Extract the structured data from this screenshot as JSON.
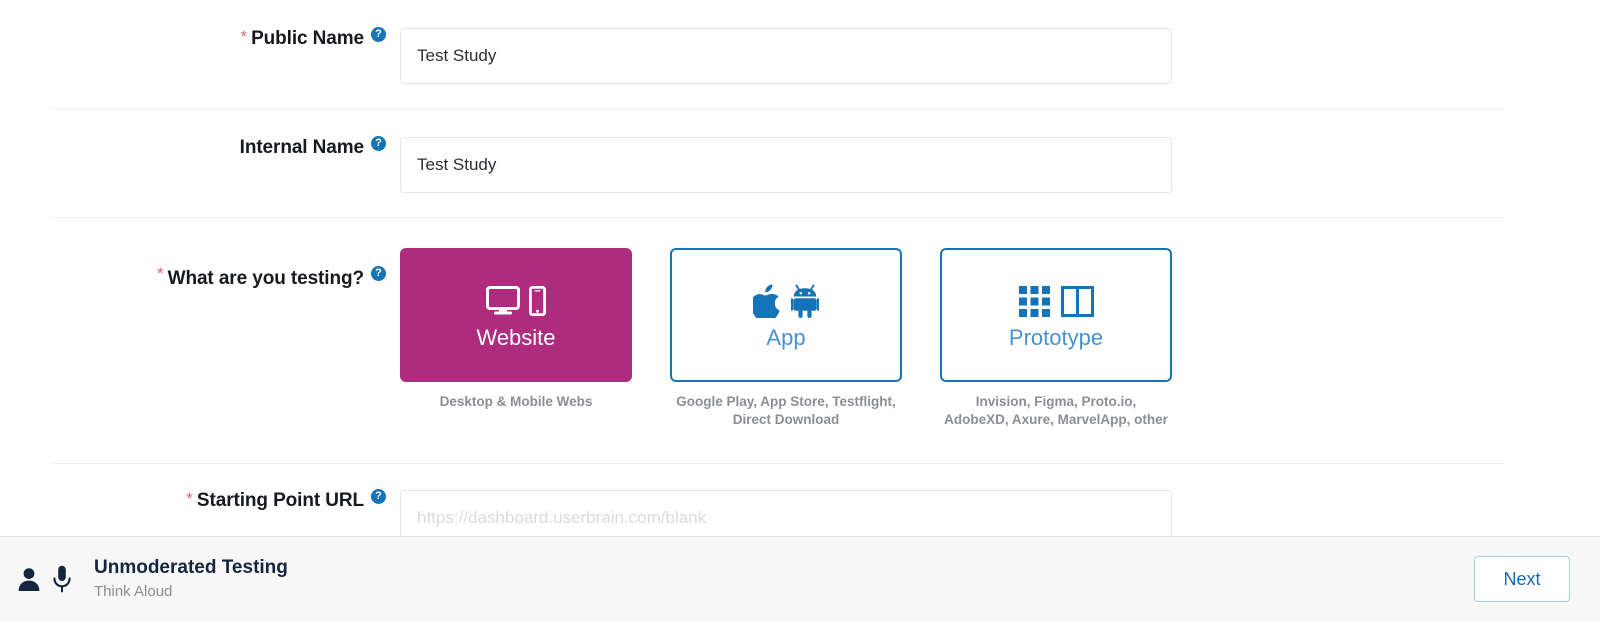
{
  "form": {
    "rows": [
      {
        "label": "Public Name",
        "required": true,
        "help_icon": "question-circle-icon",
        "value": "Test Study",
        "placeholder": ""
      },
      {
        "label": "Internal Name",
        "required": false,
        "help_icon": "question-circle-icon",
        "value": "Test Study",
        "placeholder": ""
      }
    ],
    "testing_row": {
      "label": "What are you testing?",
      "required": true,
      "help_icon": "question-circle-icon"
    },
    "starting_point_row": {
      "label": "Starting Point URL",
      "required": true,
      "help_icon": "question-circle-icon",
      "value": "",
      "placeholder": "https://dashboard.userbrain.com/blank"
    }
  },
  "cards": [
    {
      "title": "Website",
      "caption": "Desktop & Mobile Webs",
      "selected": true,
      "icons": [
        "monitor-icon",
        "smartphone-icon"
      ]
    },
    {
      "title": "App",
      "caption": "Google Play, App Store, Testflight, Direct Download",
      "selected": false,
      "icons": [
        "apple-icon",
        "android-icon"
      ]
    },
    {
      "title": "Prototype",
      "caption": "Invision, Figma, Proto.io, AdobeXD, Axure, MarvelApp, other",
      "selected": false,
      "icons": [
        "grid-icon",
        "panels-icon"
      ]
    }
  ],
  "bottom_bar": {
    "icons": [
      "person-icon",
      "microphone-icon"
    ],
    "title": "Unmoderated Testing",
    "subtitle": "Think Aloud",
    "next_label": "Next"
  },
  "colors": {
    "selected_card": "#ad2c7d",
    "accent_blue": "#1574b8",
    "card_title_blue": "#4b92cc",
    "required_star": "#d06a7c",
    "bar_title": "#13253f",
    "muted_text": "#8b8f94"
  }
}
